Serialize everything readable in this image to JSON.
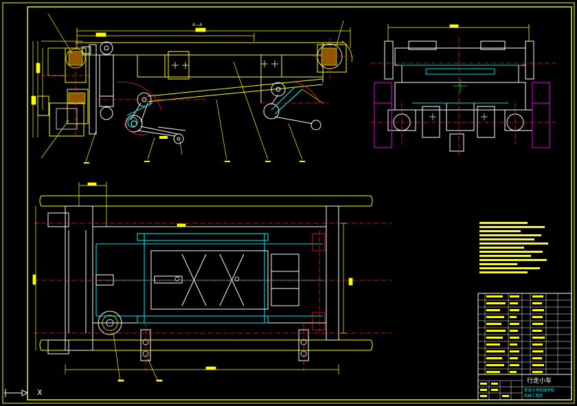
{
  "drawing": {
    "section_label": "A—A",
    "title_block": {
      "title": "行走小车",
      "line1": "某某大学机械学院",
      "line2": "机械工程系"
    }
  },
  "colors": {
    "background": "#000000",
    "primary": "#ffff00",
    "white": "#ffffff",
    "cyan": "#00e0e0",
    "red": "#ff2020",
    "magenta": "#c000c0",
    "green": "#00c000"
  },
  "ucs_icon": {
    "axis_x": "X"
  }
}
